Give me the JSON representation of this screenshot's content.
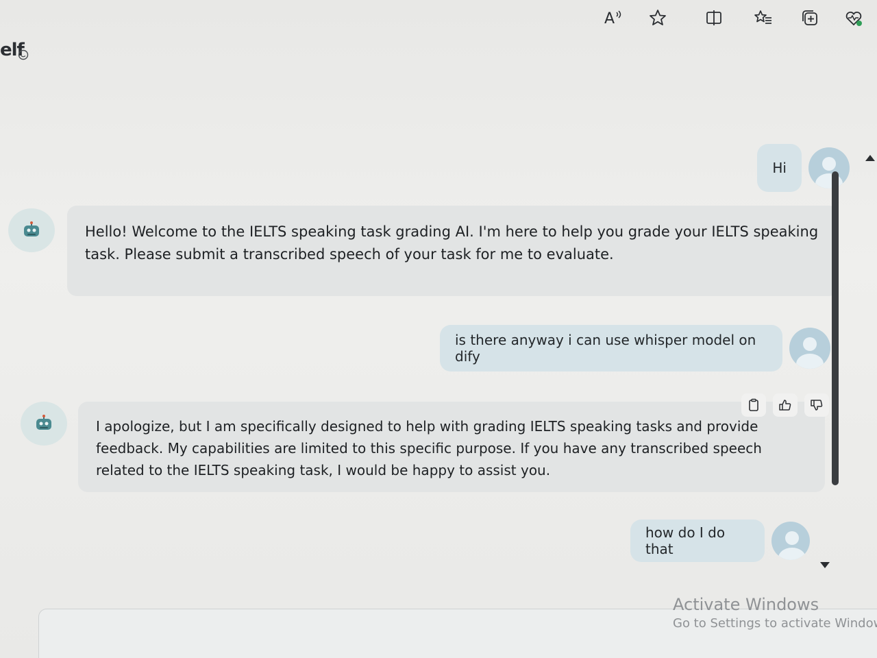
{
  "toolbar": {
    "icons": [
      "read-aloud-icon",
      "favorite-star-icon",
      "split-screen-icon",
      "favorites-list-icon",
      "collections-icon",
      "browser-essentials-icon"
    ]
  },
  "page": {
    "title": "elf",
    "title_icon": "smiley-icon"
  },
  "messages": [
    {
      "role": "user",
      "text": "Hi"
    },
    {
      "role": "bot",
      "text": "Hello! Welcome to the IELTS speaking task grading AI. I'm here to help you grade your IELTS speaking task. Please submit a transcribed speech of your task for me to evaluate."
    },
    {
      "role": "user",
      "text": "is there anyway i can use whisper model on dify"
    },
    {
      "role": "bot",
      "text": "I apologize, but I am specifically designed to help with grading IELTS speaking tasks and provide feedback. My capabilities are limited to this specific purpose. If you have any transcribed speech related to the IELTS speaking task, I would be happy to assist you."
    },
    {
      "role": "user",
      "text": "how do I do that"
    }
  ],
  "message_actions": [
    "copy-icon",
    "thumbs-up-icon",
    "thumbs-down-icon"
  ],
  "watermark": {
    "title": "Activate Windows",
    "subtitle": "Go to Settings to activate Windows."
  },
  "colors": {
    "user_bubble": "#d6e3e8",
    "bot_bubble": "#e2e4e4",
    "avatar_user": "#b7cfdb",
    "avatar_bot": "#d9e5e5"
  }
}
